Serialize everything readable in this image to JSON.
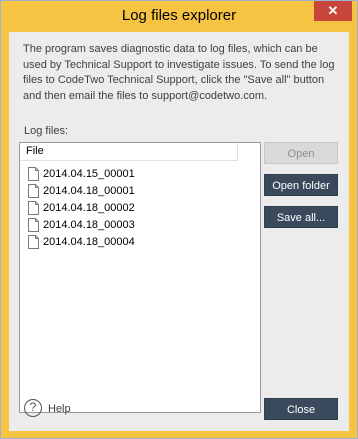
{
  "window": {
    "title": "Log files explorer",
    "close_glyph": "✕"
  },
  "description": "The program saves diagnostic data to log files, which can be used by Technical Support to investigate issues. To send the log files to CodeTwo Technical Support, click the \"Save all\" button and then email the files to support@codetwo.com.",
  "log_files_label": "Log files:",
  "list": {
    "column_header": "File",
    "items": [
      {
        "name": "2014.04.15_00001"
      },
      {
        "name": "2014.04.18_00001"
      },
      {
        "name": "2014.04.18_00002"
      },
      {
        "name": "2014.04.18_00003"
      },
      {
        "name": "2014.04.18_00004"
      }
    ]
  },
  "buttons": {
    "open": "Open",
    "open_folder": "Open folder",
    "save_all": "Save all...",
    "close": "Close"
  },
  "help": {
    "glyph": "?",
    "label": "Help"
  },
  "colors": {
    "accent_frame": "#f6c343",
    "dark_button": "#3a4a5c",
    "close_red": "#c7463b"
  },
  "icons": {
    "file": "file-icon",
    "help": "help-icon",
    "close": "close-icon"
  }
}
